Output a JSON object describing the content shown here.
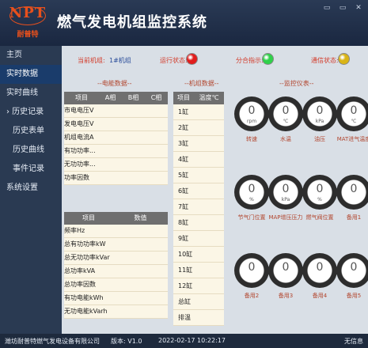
{
  "header": {
    "logo_mark": "NPT",
    "logo_sub": "耐普特",
    "title": "燃气发电机组监控系统",
    "controls": [
      "minimize-icon",
      "maximize-icon",
      "close-icon"
    ],
    "controls_glyphs": [
      "▭",
      "▭",
      "✕"
    ]
  },
  "sidebar": {
    "items": [
      {
        "label": "主页"
      },
      {
        "label": "实时数据",
        "active": true
      },
      {
        "label": "实时曲线"
      },
      {
        "label": "› 历史记录"
      },
      {
        "label": "历史表单"
      },
      {
        "label": "历史曲线"
      },
      {
        "label": "事件记录"
      },
      {
        "label": "系统设置"
      }
    ]
  },
  "status": {
    "unit_label": "当前机组:",
    "unit_value": "1#机组",
    "run_label": "运行状态:",
    "run_color": "#e11d1d",
    "split_label": "分合指示:",
    "split_color": "#2fd14a",
    "comm_label": "通信状态:",
    "comm_color": "#d9b416"
  },
  "electric": {
    "title": "--电能数据--",
    "headers": [
      "项目",
      "A相",
      "B相",
      "C相"
    ],
    "rows": [
      "市电电压V",
      "发电电压V",
      "机组电流A",
      "有功功率...",
      "无功功率...",
      "功率因数"
    ]
  },
  "total": {
    "headers": [
      "项目",
      "数值"
    ],
    "rows": [
      "频率Hz",
      "总有功功率kW",
      "总无功功率kVar",
      "总功率kVA",
      "总功率因数",
      "有功电能kWh",
      "无功电能kVarh"
    ]
  },
  "cylinder": {
    "title": "--机组数据--",
    "headers": [
      "项目",
      "温度℃"
    ],
    "rows": [
      "1缸",
      "2缸",
      "3缸",
      "4缸",
      "5缸",
      "6缸",
      "7缸",
      "8缸",
      "9缸",
      "10缸",
      "11缸",
      "12缸",
      "总缸",
      "排温"
    ]
  },
  "gauges": {
    "title": "--监控仪表--",
    "items": [
      {
        "value": "0",
        "unit": "rpm",
        "label": "转速"
      },
      {
        "value": "0",
        "unit": "℃",
        "label": "水温"
      },
      {
        "value": "0",
        "unit": "kPa",
        "label": "油压"
      },
      {
        "value": "0",
        "unit": "℃",
        "label": "MAT进气温度"
      },
      {
        "value": "0",
        "unit": "%",
        "label": "节气门位置"
      },
      {
        "value": "0",
        "unit": "kPa",
        "label": "MAP增压压力"
      },
      {
        "value": "0",
        "unit": "%",
        "label": "燃气阀位置"
      },
      {
        "value": "0",
        "unit": "",
        "label": "备用1"
      },
      {
        "value": "0",
        "unit": "",
        "label": "备用2"
      },
      {
        "value": "0",
        "unit": "",
        "label": "备用3"
      },
      {
        "value": "0",
        "unit": "",
        "label": "备用4"
      },
      {
        "value": "0",
        "unit": "",
        "label": "备用5"
      }
    ]
  },
  "footer": {
    "company": "潍坊耐普特燃气发电设备有限公司",
    "version": "版本: V1.0",
    "datetime": "2022-02-17 10:22:17",
    "alarm": "无信息"
  }
}
